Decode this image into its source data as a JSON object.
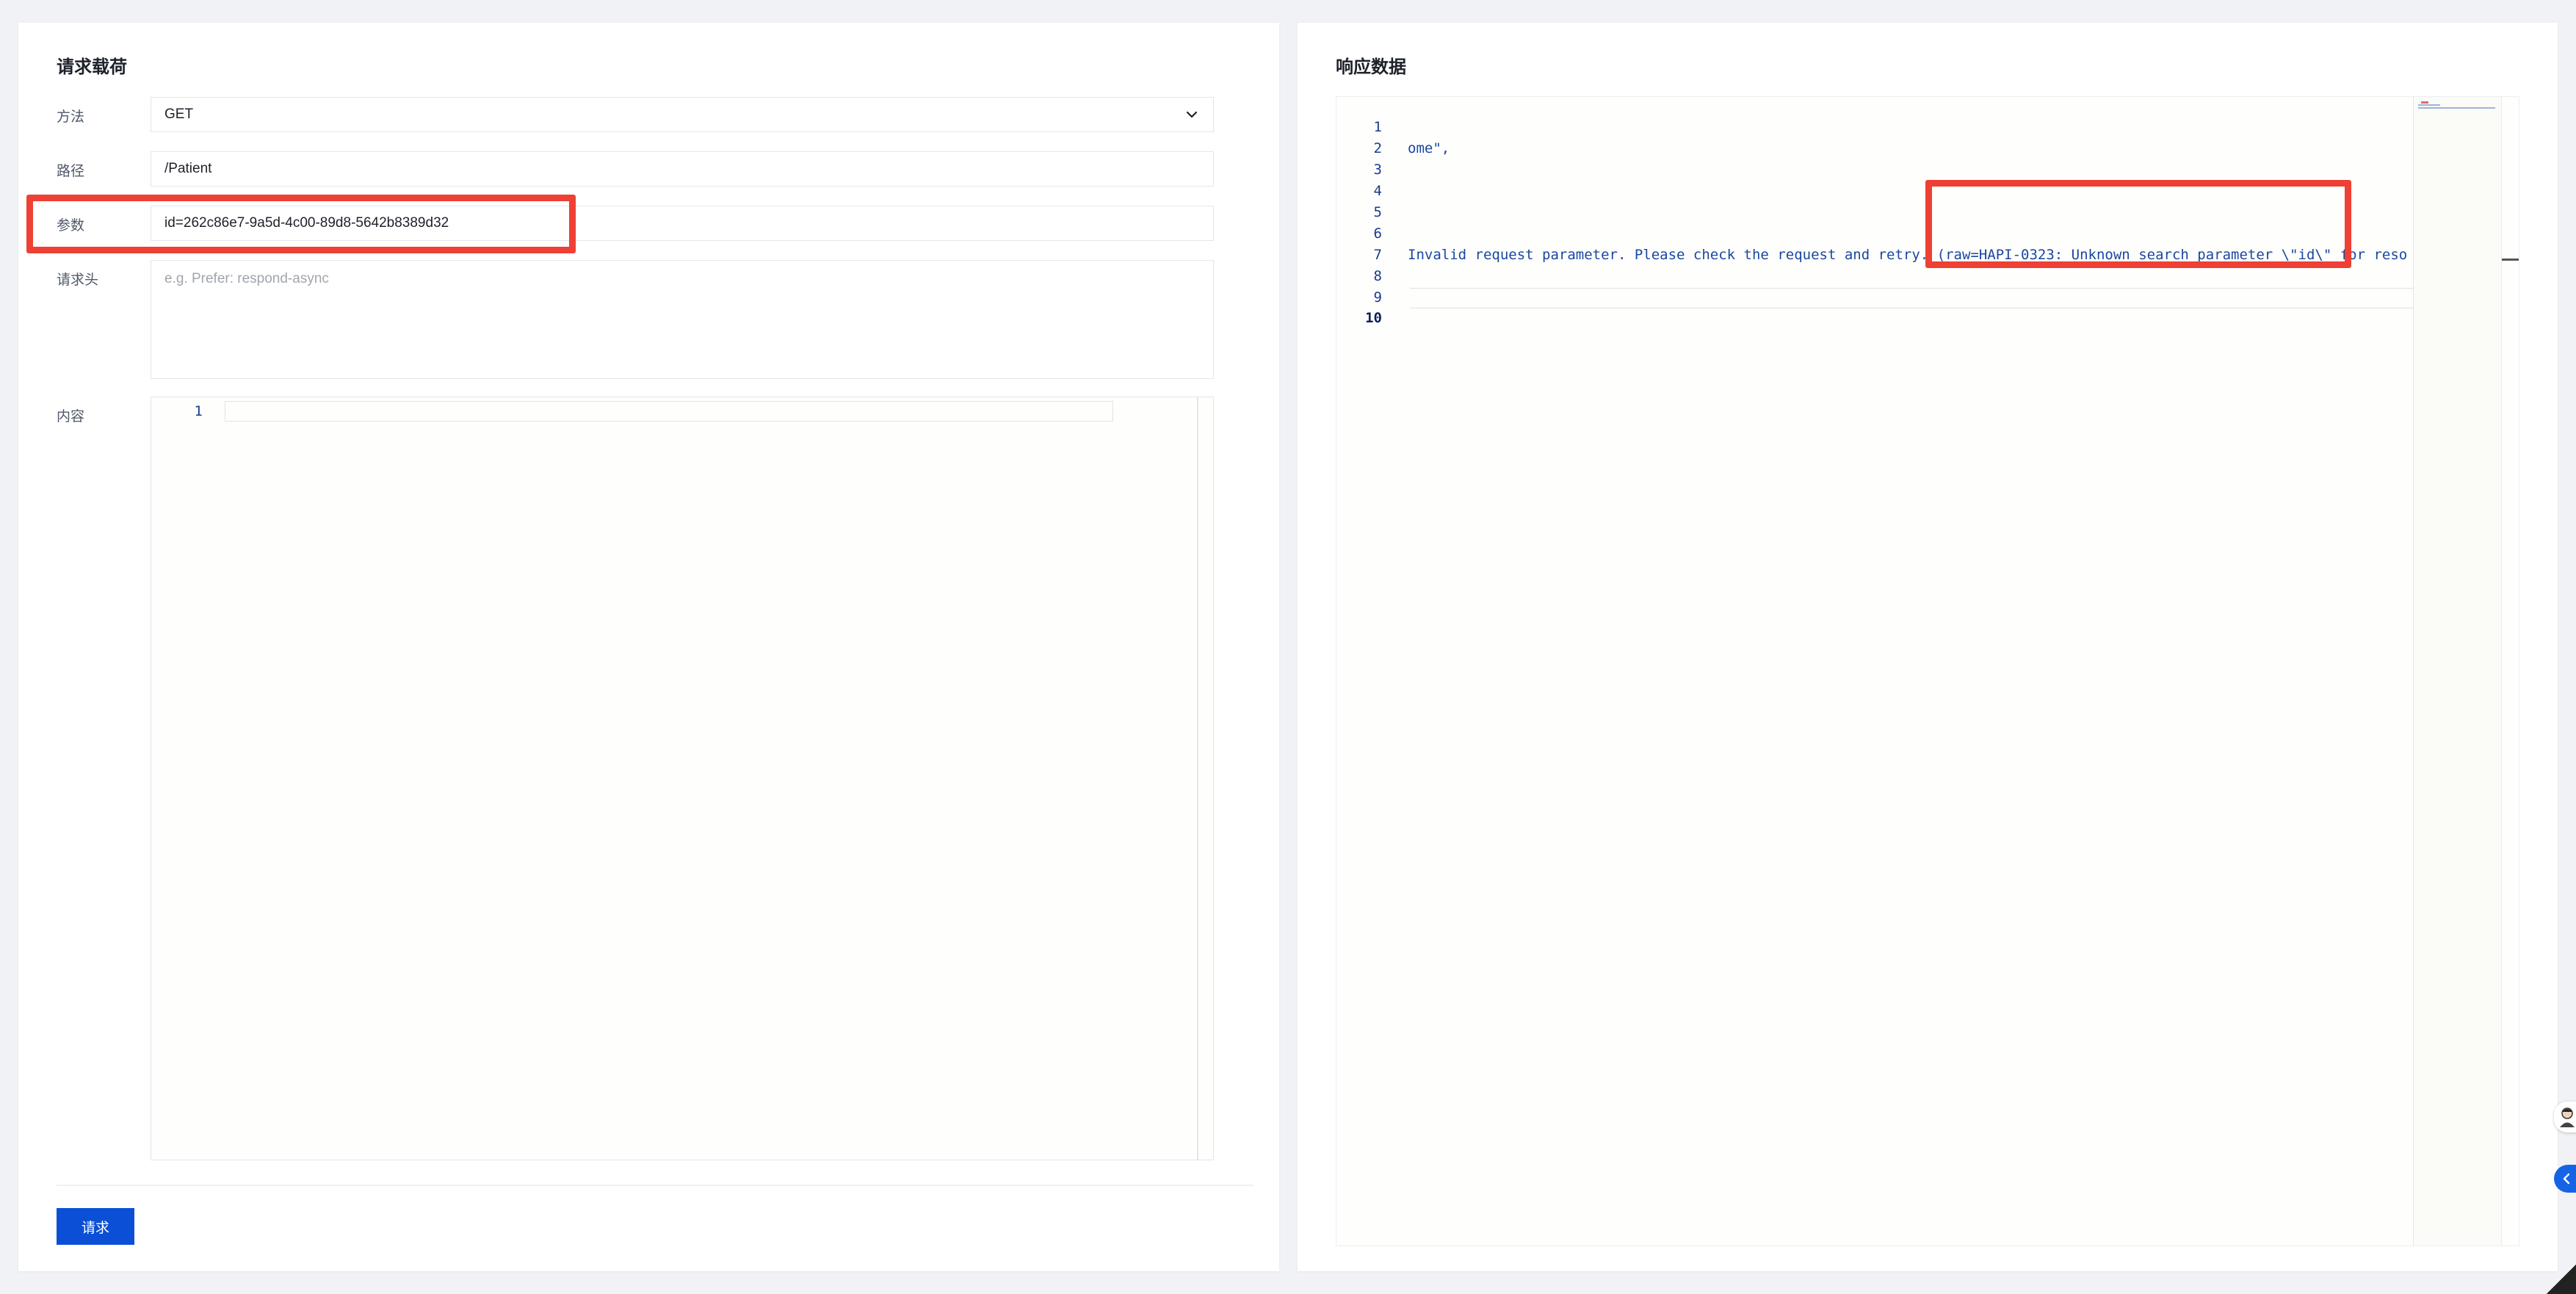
{
  "request_panel": {
    "title": "请求载荷",
    "method": {
      "label": "方法",
      "value": "GET"
    },
    "path": {
      "label": "路径",
      "value": "/Patient"
    },
    "params": {
      "label": "参数",
      "value": "id=262c86e7-9a5d-4c00-89d8-5642b8389d32"
    },
    "headers": {
      "label": "请求头",
      "placeholder": "e.g. Prefer: respond-async"
    },
    "body": {
      "label": "内容",
      "line_numbers": [
        "1"
      ]
    },
    "submit_label": "请求"
  },
  "response_panel": {
    "title": "响应数据",
    "line_numbers": [
      "1",
      "2",
      "3",
      "4",
      "5",
      "6",
      "7",
      "8",
      "9",
      "10"
    ],
    "active_line": "10",
    "lines": [
      "",
      "ome\",",
      "",
      "",
      "",
      "",
      "Invalid request parameter. Please check the request and retry. (raw=HAPI-0323: Unknown search parameter \\\"id\\\" for reso",
      "",
      "",
      ""
    ]
  },
  "colors": {
    "accent": "#0a4fd6",
    "highlight": "#ee4034",
    "code_text": "#1a47a3"
  },
  "icons": {
    "method_dropdown": "chevron-down-icon",
    "floating_collapse": "chevron-left-icon",
    "floating_avatar": "avatar-icon"
  }
}
